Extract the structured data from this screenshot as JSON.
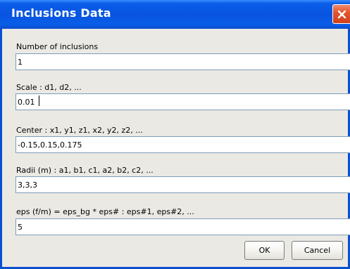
{
  "window": {
    "title": "Inclusions Data"
  },
  "fields": [
    {
      "label": "Number of inclusions",
      "value": "1"
    },
    {
      "label": "Scale : d1, d2, ...",
      "value": "0.01"
    },
    {
      "label": "Center : x1, y1, z1, x2, y2, z2, ...",
      "value": "-0.15,0.15,0.175"
    },
    {
      "label": "Radii (m) : a1, b1, c1, a2, b2, c2, ...",
      "value": "3,3,3"
    },
    {
      "label": "eps (f/m) = eps_bg * eps# : eps#1, eps#2, ...",
      "value": "5"
    }
  ],
  "buttons": {
    "ok_label": "OK",
    "cancel_label": "Cancel"
  },
  "colors": {
    "titlebar": "#0854e0",
    "close_button": "#e3552f",
    "dialog_bg": "#ebe9e4",
    "field_border": "#7f9db9"
  },
  "icons": {
    "close": "close-icon"
  }
}
